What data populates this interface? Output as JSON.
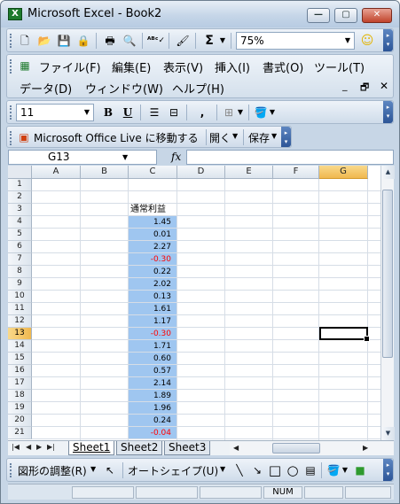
{
  "window": {
    "title": "Microsoft Excel - Book2",
    "app_icon": "excel-icon"
  },
  "standard_toolbar": {
    "buttons": [
      "new-icon",
      "open-icon",
      "save-icon",
      "permission-icon",
      "print-icon",
      "print-preview-icon",
      "spelling-icon",
      "format-painter-icon",
      "autosum-icon"
    ],
    "zoom": "75%"
  },
  "menu": {
    "items": [
      "ファイル(F)",
      "編集(E)",
      "表示(V)",
      "挿入(I)",
      "書式(O)",
      "ツール(T)",
      "データ(D)",
      "ウィンドウ(W)",
      "ヘルプ(H)"
    ]
  },
  "formatting_toolbar": {
    "font_size": "11",
    "bold": "B",
    "underline": "U",
    "comma": ","
  },
  "live_toolbar": {
    "label": "Microsoft Office Live に移動する",
    "open": "開く",
    "save": "保存"
  },
  "formula_bar": {
    "name_box": "G13",
    "fx": "fx",
    "formula": ""
  },
  "grid": {
    "columns": [
      "A",
      "B",
      "C",
      "D",
      "E",
      "F",
      "G"
    ],
    "selected_column": "G",
    "rows": [
      "1",
      "2",
      "3",
      "4",
      "5",
      "6",
      "7",
      "8",
      "9",
      "10",
      "11",
      "12",
      "13",
      "14",
      "15",
      "16",
      "17",
      "18",
      "19",
      "20",
      "21"
    ],
    "selected_row": "13",
    "c_header": "通常利益",
    "c_values": [
      "1.45",
      "0.01",
      "2.27",
      "-0.30",
      "0.22",
      "2.02",
      "0.13",
      "1.61",
      "1.17",
      "-0.30",
      "1.71",
      "0.60",
      "0.57",
      "2.14",
      "1.89",
      "1.96",
      "0.24",
      "-0.04"
    ]
  },
  "sheets": [
    "Sheet1",
    "Sheet2",
    "Sheet3"
  ],
  "drawing_toolbar": {
    "adjust": "図形の調整(R)",
    "autoshape": "オートシェイプ(U)"
  },
  "status": {
    "num": "NUM"
  },
  "colors": {
    "selection": "#9fc6f0",
    "negative": "#ff0000",
    "accent": "#2c5597"
  }
}
